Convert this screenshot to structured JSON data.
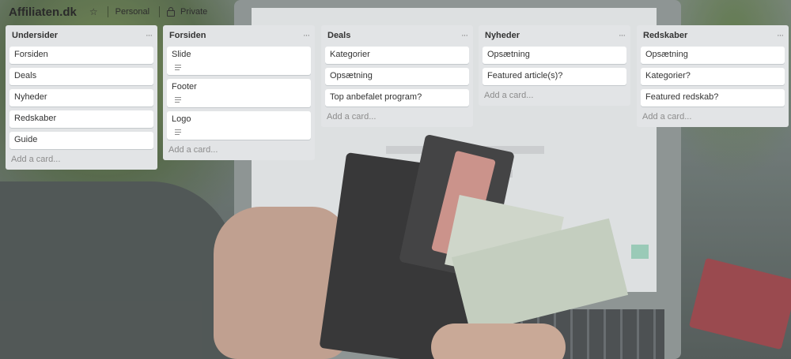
{
  "board": {
    "title": "Affiliaten.dk",
    "team": "Personal",
    "visibility": "Private"
  },
  "icons": {
    "star": "star-icon",
    "lock": "lock-icon",
    "list_menu": "ellipsis-icon",
    "description": "description-icon"
  },
  "colors": {
    "list_bg": "#e2e4e6",
    "card_bg": "#ffffff",
    "add_card_text": "#8c8c8c"
  },
  "lists": [
    {
      "title": "Undersider",
      "cards": [
        {
          "title": "Forsiden"
        },
        {
          "title": "Deals"
        },
        {
          "title": "Nyheder"
        },
        {
          "title": "Redskaber"
        },
        {
          "title": "Guide"
        }
      ],
      "add_card": "Add a card..."
    },
    {
      "title": "Forsiden",
      "cards": [
        {
          "title": "Slide",
          "has_description": true
        },
        {
          "title": "Footer",
          "has_description": true
        },
        {
          "title": "Logo",
          "has_description": true
        }
      ],
      "add_card": "Add a card..."
    },
    {
      "title": "Deals",
      "cards": [
        {
          "title": "Kategorier"
        },
        {
          "title": "Opsætning"
        },
        {
          "title": "Top anbefalet program?"
        }
      ],
      "add_card": "Add a card..."
    },
    {
      "title": "Nyheder",
      "cards": [
        {
          "title": "Opsætning"
        },
        {
          "title": "Featured article(s)?"
        }
      ],
      "add_card": "Add a card..."
    },
    {
      "title": "Redskaber",
      "cards": [
        {
          "title": "Opsætning"
        },
        {
          "title": "Kategorier?"
        },
        {
          "title": "Featured redskab?"
        }
      ],
      "add_card": "Add a card..."
    }
  ]
}
